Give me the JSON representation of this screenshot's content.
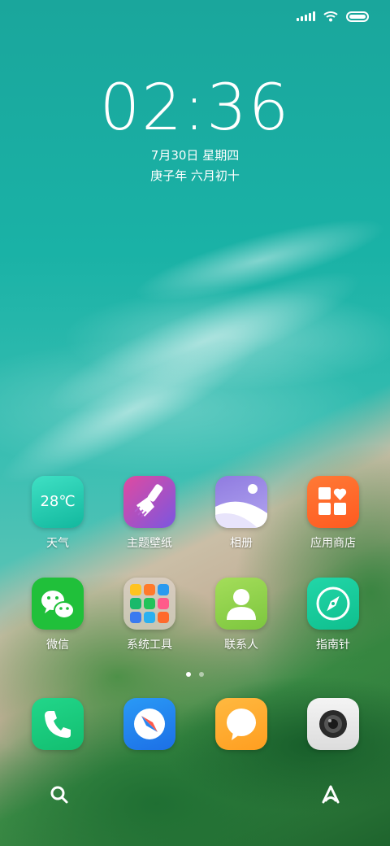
{
  "status_bar": {
    "signal_icon": "cellular-signal-icon",
    "wifi_icon": "wifi-icon",
    "battery_icon": "battery-icon"
  },
  "lock_clock": {
    "time": "02:36",
    "date": "7月30日 星期四",
    "lunar_date": "庚子年 六月初十"
  },
  "apps_row1": [
    {
      "label": "天气",
      "icon": "weather-icon",
      "badge_text": "28℃"
    },
    {
      "label": "主题壁纸",
      "icon": "theme-brush-icon"
    },
    {
      "label": "相册",
      "icon": "gallery-icon"
    },
    {
      "label": "应用商店",
      "icon": "app-store-icon"
    }
  ],
  "apps_row2": [
    {
      "label": "微信",
      "icon": "wechat-icon"
    },
    {
      "label": "系统工具",
      "icon": "folder-icon"
    },
    {
      "label": "联系人",
      "icon": "contacts-icon"
    },
    {
      "label": "指南针",
      "icon": "compass-icon"
    }
  ],
  "dock": [
    {
      "icon": "phone-icon"
    },
    {
      "icon": "browser-icon"
    },
    {
      "icon": "messages-icon"
    },
    {
      "icon": "camera-icon"
    }
  ],
  "page_indicator": {
    "pages": 2,
    "active_page": 1
  },
  "bottom_bar": {
    "left_icon": "search-icon",
    "right_icon": "assistant-icon"
  },
  "colors": {
    "weather": "#19c6a4",
    "theme": "#9a52d8",
    "gallery": "#8f7be0",
    "app_store": "#ff6a2b",
    "wechat": "#20c03a",
    "contacts": "#8fd14a",
    "compass": "#14c79a",
    "phone": "#19c77a",
    "browser": "#2a86f0",
    "messages": "#ffab2e",
    "camera": "#e9e9e9"
  }
}
